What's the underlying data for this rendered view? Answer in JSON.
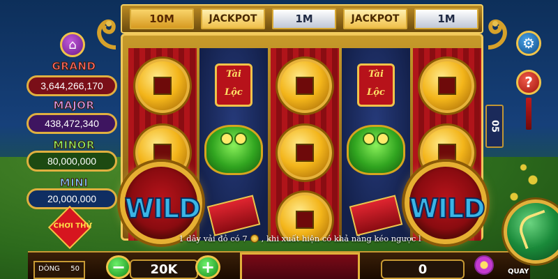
{
  "top_row": [
    {
      "label": "10M",
      "style": "gold"
    },
    {
      "label": "JACKPOT",
      "style": "jackpot"
    },
    {
      "label": "1M",
      "style": "silver"
    },
    {
      "label": "JACKPOT",
      "style": "jackpot"
    },
    {
      "label": "1M",
      "style": "silver"
    }
  ],
  "jackpots": {
    "grand": {
      "label": "GRAND",
      "value": "3,644,266,170",
      "color": "#e6434a"
    },
    "major": {
      "label": "MAJOR",
      "value": "438,472,340",
      "color": "#b56ce6"
    },
    "minor": {
      "label": "MINOR",
      "value": "80,000,000",
      "color": "#64d04a"
    },
    "mini": {
      "label": "MINI",
      "value": "20,000,000",
      "color": "#4aa8f0"
    }
  },
  "reels": [
    {
      "type": "coins"
    },
    {
      "type": "lucky",
      "scroll_text": "Tài Lộc"
    },
    {
      "type": "coins"
    },
    {
      "type": "lucky",
      "scroll_text": "Tài Lộc"
    },
    {
      "type": "coins"
    }
  ],
  "wild_label": "WILD",
  "line_count_label": "05",
  "choi_thu_label": "CHƠI THỬ",
  "message": {
    "before": "1 dây vải đỏ có 7",
    "after": ", khi xuất hiện có khả năng kéo ngược l"
  },
  "bottom": {
    "lines_label": "DÒNG",
    "lines_value": "50",
    "bet_value": "20K",
    "win_value": "0",
    "minus_label": "−",
    "plus_label": "+",
    "spin_label": "QUAY"
  },
  "icons": {
    "home": "home-icon",
    "settings": "gear-icon",
    "help": "question-icon"
  },
  "colors": {
    "frame_gold": "#f1c85a",
    "reel_red": "#b0141a",
    "reel_dark": "#13204a"
  }
}
